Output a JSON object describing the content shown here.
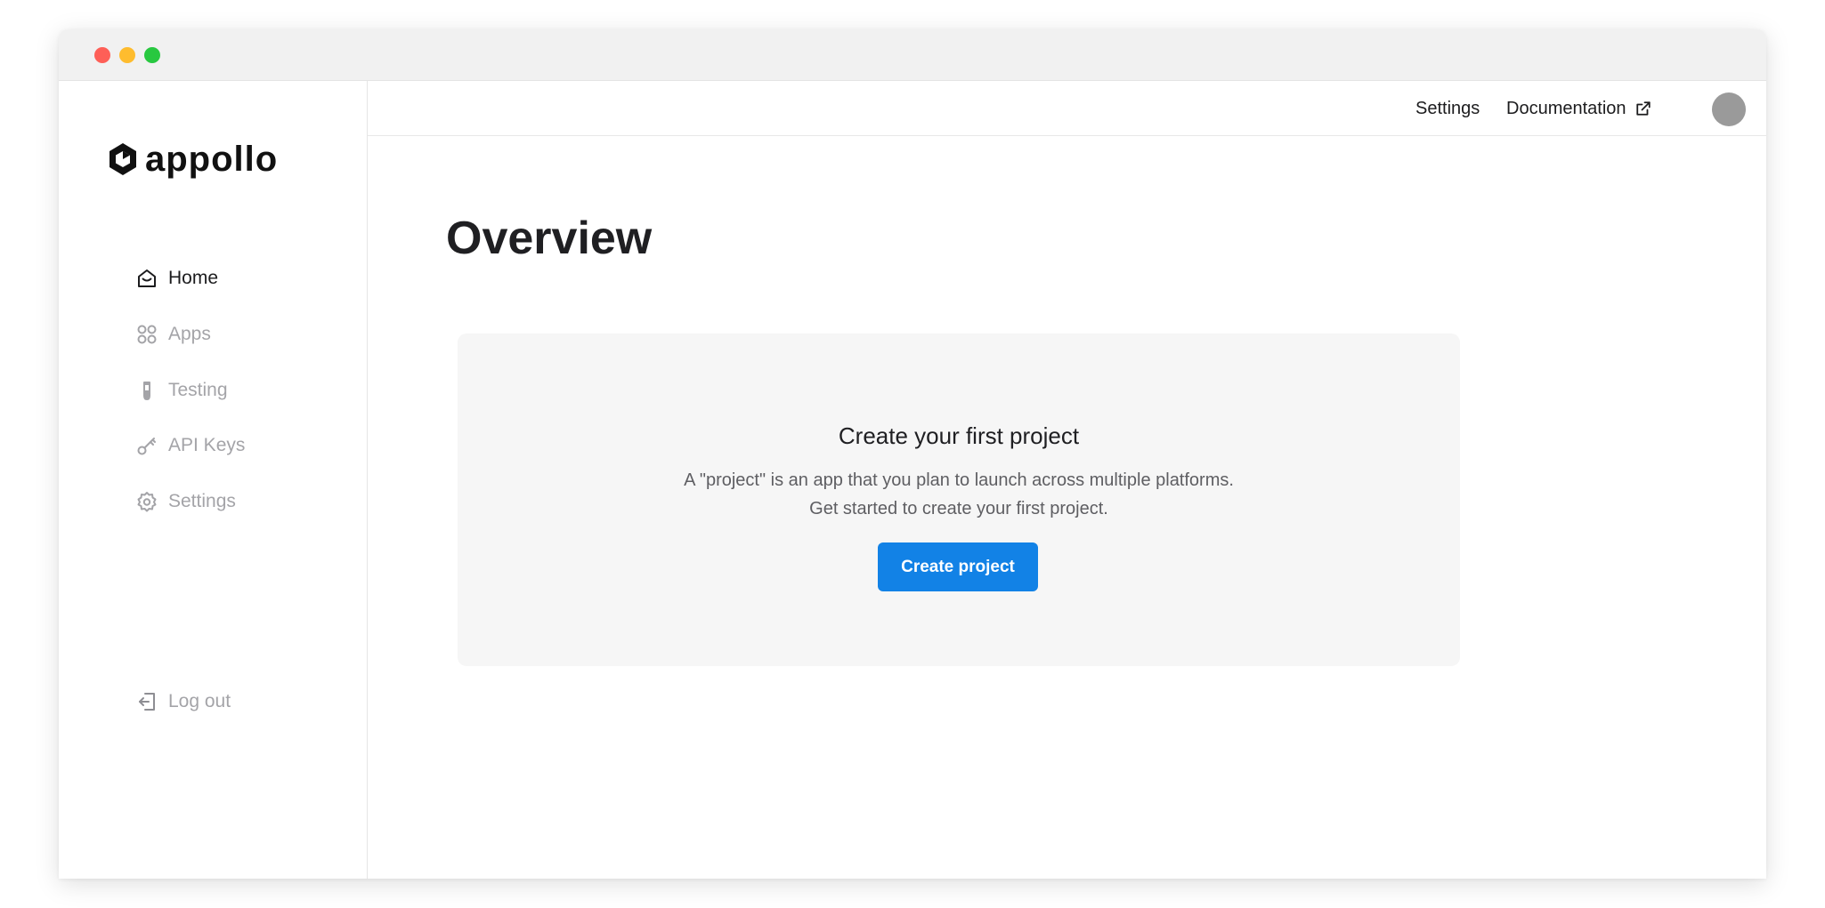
{
  "window": {
    "controls": [
      "close",
      "minimize",
      "maximize"
    ]
  },
  "brand": {
    "logo_icon": "appollo-hexagon-logo-icon",
    "name": "appollo"
  },
  "sidebar": {
    "items": [
      {
        "label": "Home",
        "icon": "home-icon",
        "active": true
      },
      {
        "label": "Apps",
        "icon": "apps-grid-icon",
        "active": false
      },
      {
        "label": "Testing",
        "icon": "test-tube-icon",
        "active": false
      },
      {
        "label": "API Keys",
        "icon": "key-icon",
        "active": false
      },
      {
        "label": "Settings",
        "icon": "gear-icon",
        "active": false
      }
    ],
    "logout": {
      "label": "Log out",
      "icon": "logout-icon"
    }
  },
  "topbar": {
    "settings_label": "Settings",
    "documentation_label": "Documentation",
    "documentation_icon": "external-link-icon",
    "avatar_icon": "user-avatar"
  },
  "main": {
    "title": "Overview",
    "empty_state": {
      "title": "Create your first project",
      "description_line1": "A \"project\" is an app that you plan to launch across multiple platforms.",
      "description_line2": "Get started to create your first project.",
      "button_label": "Create project"
    }
  },
  "colors": {
    "accent": "#1282e6",
    "text_primary": "#1c1c1e",
    "text_muted": "#a4a4a8",
    "card_bg": "#f6f6f6"
  }
}
